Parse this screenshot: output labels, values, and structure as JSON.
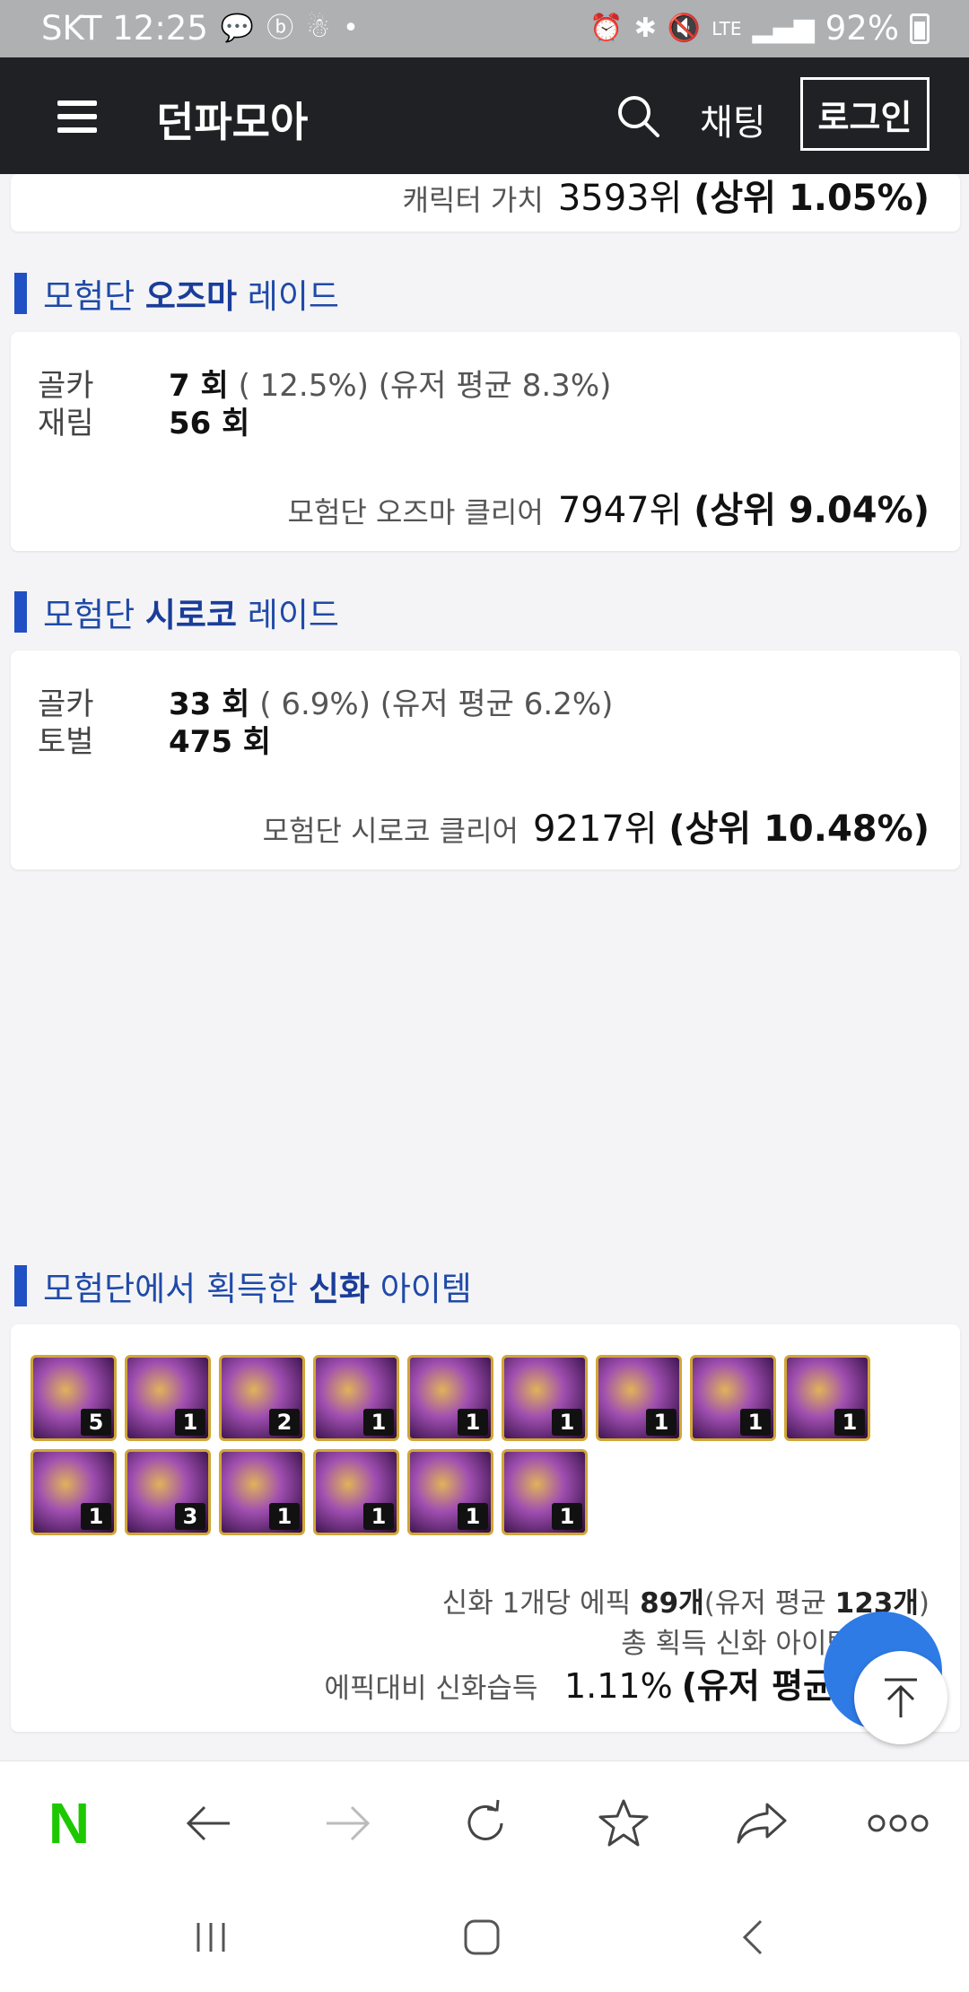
{
  "status_bar": {
    "carrier_time": "SKT 12:25",
    "net": "LTE",
    "battery": "92%"
  },
  "header": {
    "title": "던파모아",
    "chat": "채팅",
    "login": "로그인"
  },
  "top_card": {
    "label": "캐릭터 가치",
    "rank": "3593위",
    "percent": "(상위 1.05%)"
  },
  "ozma": {
    "title_pre": "모험단",
    "title_bold": "오즈마",
    "title_post": "레이드",
    "rows": [
      {
        "label": "골카",
        "count": "7 회",
        "detail": "( 12.5%) (유저 평균 8.3%)"
      },
      {
        "label": "재림",
        "count": "56 회",
        "detail": ""
      }
    ],
    "rank_label": "모험단 오즈마 클리어",
    "rank": "7947위",
    "percent": "(상위 9.04%)"
  },
  "sirocco": {
    "title_pre": "모험단",
    "title_bold": "시로코",
    "title_post": "레이드",
    "rows": [
      {
        "label": "골카",
        "count": "33 회",
        "detail": "( 6.9%) (유저 평균 6.2%)"
      },
      {
        "label": "토벌",
        "count": "475 회",
        "detail": ""
      }
    ],
    "rank_label": "모험단 시로코 클리어",
    "rank": "9217위",
    "percent": "(상위 10.48%)"
  },
  "myth": {
    "title_pre": "모험단에서 획득한",
    "title_bold": "신화",
    "title_post": "아이템",
    "items": [
      {
        "count": "5"
      },
      {
        "count": "1"
      },
      {
        "count": "2"
      },
      {
        "count": "1"
      },
      {
        "count": "1"
      },
      {
        "count": "1"
      },
      {
        "count": "1"
      },
      {
        "count": "1"
      },
      {
        "count": "1"
      },
      {
        "count": "1"
      },
      {
        "count": "3"
      },
      {
        "count": "1"
      },
      {
        "count": "1"
      },
      {
        "count": "1"
      },
      {
        "count": "1"
      }
    ],
    "line1_pre": "신화 1개당 에픽",
    "line1_val": "89개",
    "line1_mid": "(유저 평균",
    "line1_avg": "123개",
    "line1_end": ")",
    "line2": "총 획득 신화 아이템",
    "line3_label": "에픽대비 신화습득",
    "line3_val": "1.11%",
    "line3_tail": "(유저 평균"
  }
}
